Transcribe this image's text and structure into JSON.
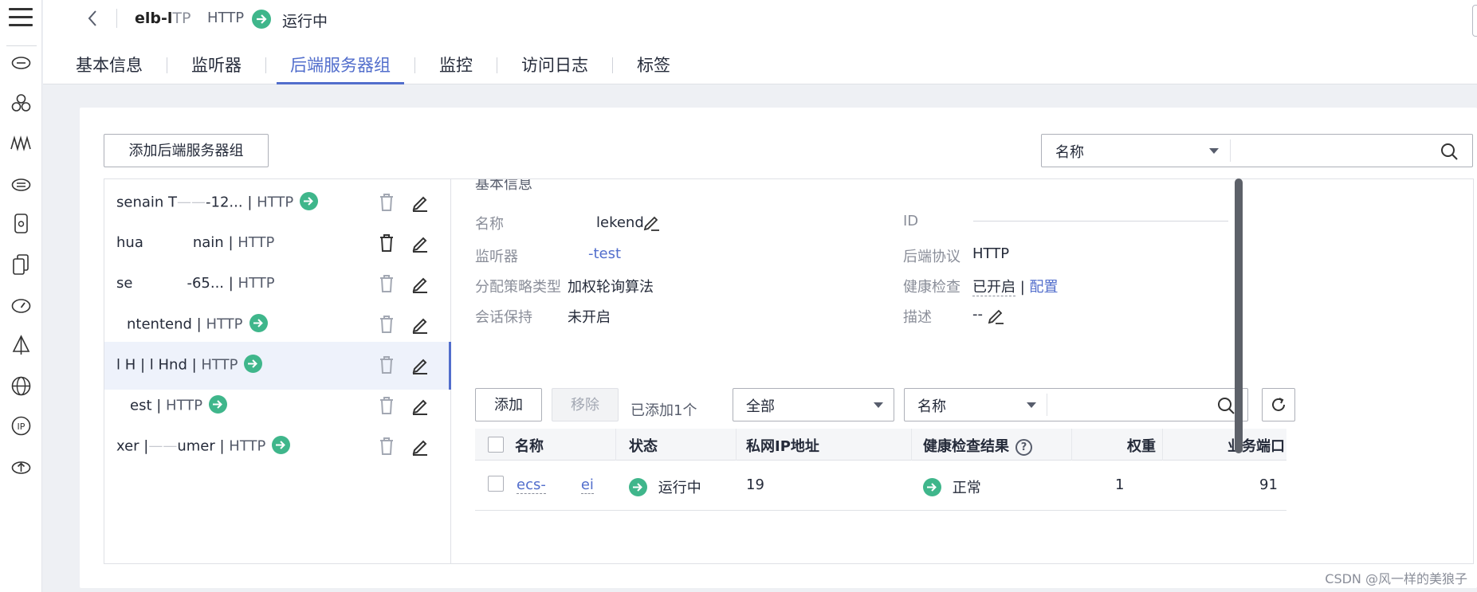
{
  "rail": {
    "icons": [
      "menu-icon",
      "cloud-router-icon",
      "cluster-icon",
      "waveform-icon",
      "cloud-disk-icon",
      "device-icon",
      "copy-device-icon",
      "cloud-speed-icon",
      "sail-icon",
      "globe-web-icon",
      "ip-icon",
      "cloud-upload-icon"
    ]
  },
  "header": {
    "elb_name": "elb-l",
    "elb_name_tail": "TP",
    "protocol": "HTTP",
    "status": "运行中",
    "tabs": [
      "基本信息",
      "监听器",
      "后端服务器组",
      "监控",
      "访问日志",
      "标签"
    ],
    "active_tab": "后端服务器组"
  },
  "toolbar": {
    "add_group_label": "添加后端服务器组",
    "search_field": "名称"
  },
  "groups": [
    {
      "name": "senain   T",
      "suffix": "-12...",
      "protocol": "HTTP",
      "has_listener": true,
      "selected": false
    },
    {
      "name": "hua",
      "suffix": "nain",
      "protocol": "HTTP",
      "has_listener": false,
      "selected": false
    },
    {
      "name": "se",
      "suffix": "-65...",
      "protocol": "HTTP",
      "has_listener": false,
      "selected": false
    },
    {
      "name": "",
      "suffix": "ntentend",
      "protocol": "HTTP",
      "has_listener": true,
      "selected": false
    },
    {
      "name": "l H | l H",
      "suffix": "nd",
      "protocol": "HTTP",
      "has_listener": true,
      "selected": true
    },
    {
      "name": "",
      "suffix": "est",
      "protocol": "HTTP",
      "has_listener": true,
      "selected": false
    },
    {
      "name": "xer |",
      "suffix": "umer",
      "protocol": "HTTP",
      "has_listener": true,
      "selected": false
    }
  ],
  "detail": {
    "section_title": "基本信息",
    "name_label": "名称",
    "name_value": "lekend",
    "id_label": "ID",
    "listener_label": "监听器",
    "listener_value": "-test",
    "backend_protocol_label": "后端协议",
    "backend_protocol_value": "HTTP",
    "policy_label": "分配策略类型",
    "policy_value": "加权轮询算法",
    "health_label": "健康检查",
    "health_value": "已开启",
    "health_sep": "|",
    "health_config": "配置",
    "session_label": "会话保持",
    "session_value": "未开启",
    "desc_label": "描述",
    "desc_value": "--"
  },
  "servers": {
    "add_label": "添加",
    "remove_label": "移除",
    "added_count": "已添加1个",
    "filter_all": "全部",
    "search_field": "名称",
    "columns": [
      "名称",
      "状态",
      "私网IP地址",
      "健康检查结果",
      "权重",
      "业务端口"
    ],
    "rows": [
      {
        "name": "ecs-",
        "name_tail": "ei",
        "status": "运行中",
        "ip": "19",
        "health": "正常",
        "weight": "1",
        "port": "91"
      }
    ]
  },
  "watermark": "CSDN @风一样的美狼子",
  "colors": {
    "accent": "#526ecc",
    "ok": "#3fb68b",
    "text": "#252b3a",
    "muted": "#8a8e99"
  }
}
